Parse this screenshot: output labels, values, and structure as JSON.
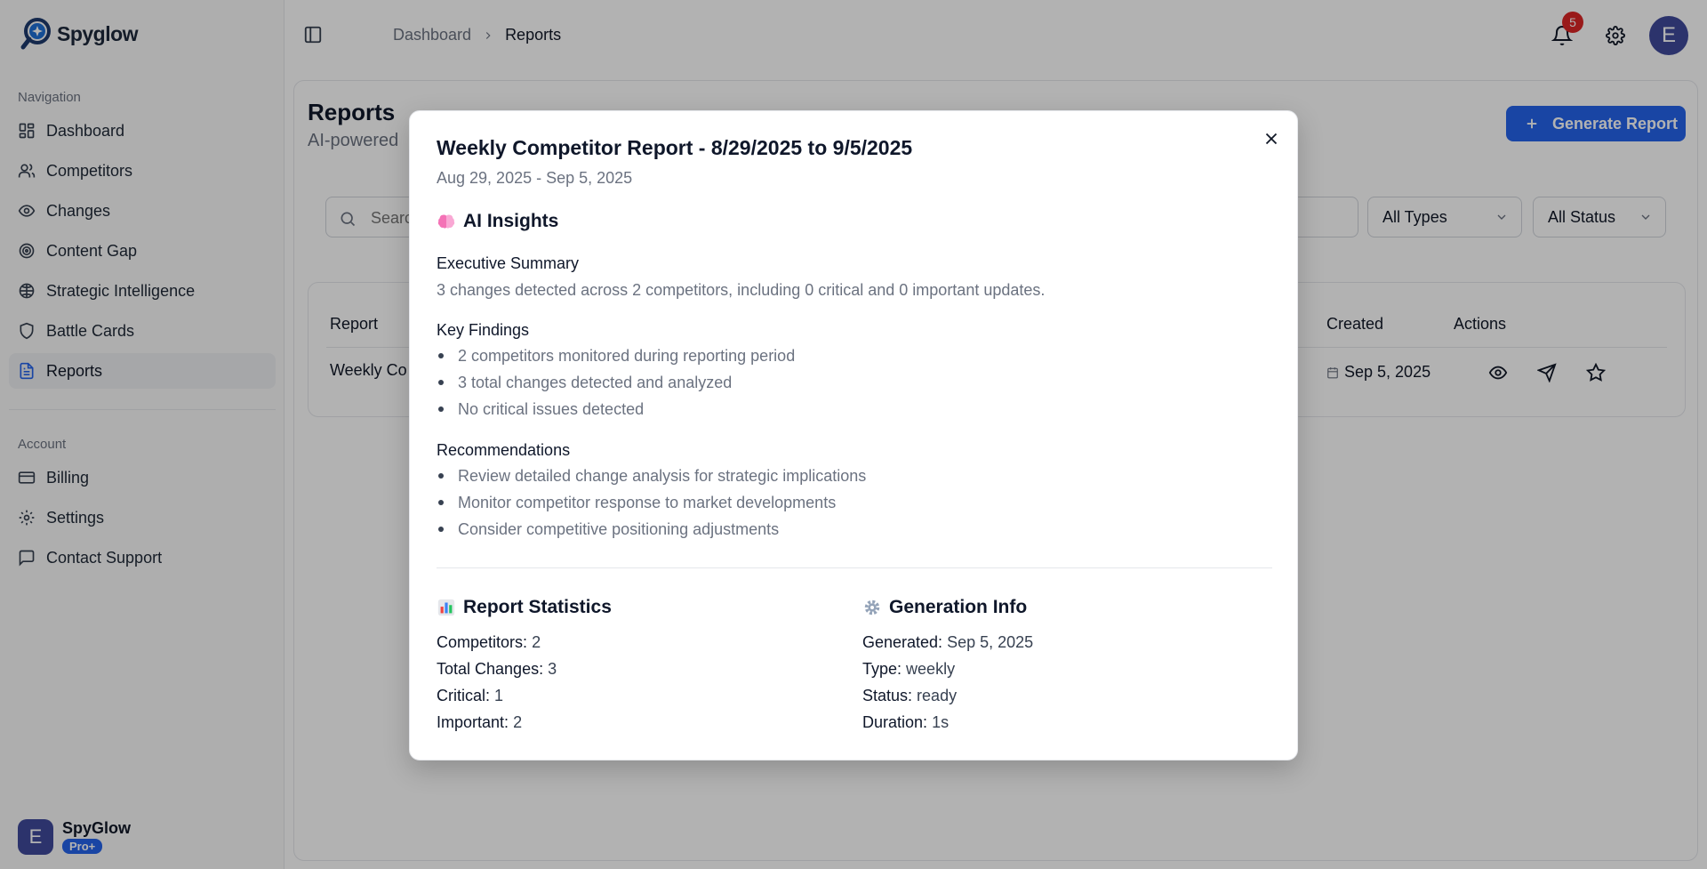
{
  "app": {
    "name": "Spyglow"
  },
  "sidebar": {
    "nav_label": "Navigation",
    "nav_items": [
      {
        "label": "Dashboard",
        "icon": "dashboard-icon"
      },
      {
        "label": "Competitors",
        "icon": "users-icon"
      },
      {
        "label": "Changes",
        "icon": "eye-icon"
      },
      {
        "label": "Content Gap",
        "icon": "target-icon"
      },
      {
        "label": "Strategic Intelligence",
        "icon": "brain-icon"
      },
      {
        "label": "Battle Cards",
        "icon": "shield-icon"
      },
      {
        "label": "Reports",
        "icon": "file-text-icon",
        "active": true
      }
    ],
    "account_label": "Account",
    "account_items": [
      {
        "label": "Billing",
        "icon": "credit-card-icon"
      },
      {
        "label": "Settings",
        "icon": "gear-icon"
      },
      {
        "label": "Contact Support",
        "icon": "message-square-icon"
      }
    ],
    "user": {
      "initial": "E",
      "name": "SpyGlow",
      "plan": "Pro+"
    }
  },
  "header": {
    "breadcrumb": [
      "Dashboard",
      "Reports"
    ],
    "notification_count": "5",
    "avatar_initial": "E"
  },
  "main": {
    "title": "Reports",
    "subtitle": "AI-powered",
    "generate_button": "Generate Report",
    "search_placeholder": "Search",
    "type_filter": "All Types",
    "status_filter": "All Status",
    "table": {
      "columns": [
        "Report",
        "Created",
        "Actions"
      ],
      "rows": [
        {
          "report": "Weekly Co",
          "created": "Sep 5, 2025"
        }
      ]
    }
  },
  "modal": {
    "title": "Weekly Competitor Report - 8/29/2025 to 9/5/2025",
    "date_range": "Aug 29, 2025 - Sep 5, 2025",
    "insights_title": "AI Insights",
    "executive_summary_label": "Executive Summary",
    "executive_summary": "3 changes detected across 2 competitors, including 0 critical and 0 important updates.",
    "key_findings_label": "Key Findings",
    "key_findings": [
      "2 competitors monitored during reporting period",
      "3 total changes detected and analyzed",
      "No critical issues detected"
    ],
    "recommendations_label": "Recommendations",
    "recommendations": [
      "Review detailed change analysis for strategic implications",
      "Monitor competitor response to market developments",
      "Consider competitive positioning adjustments"
    ],
    "stats_title": "Report Statistics",
    "stats": [
      {
        "label": "Competitors:",
        "value": "2"
      },
      {
        "label": "Total Changes:",
        "value": "3"
      },
      {
        "label": "Critical:",
        "value": "1"
      },
      {
        "label": "Important:",
        "value": "2"
      }
    ],
    "generation_title": "Generation Info",
    "generation": [
      {
        "label": "Generated:",
        "value": "Sep 5, 2025"
      },
      {
        "label": "Type:",
        "value": "weekly"
      },
      {
        "label": "Status:",
        "value": "ready"
      },
      {
        "label": "Duration:",
        "value": "1s"
      }
    ]
  },
  "colors": {
    "accent": "#2563eb",
    "badge": "#dc2626",
    "avatar": "#3f4a9b"
  }
}
